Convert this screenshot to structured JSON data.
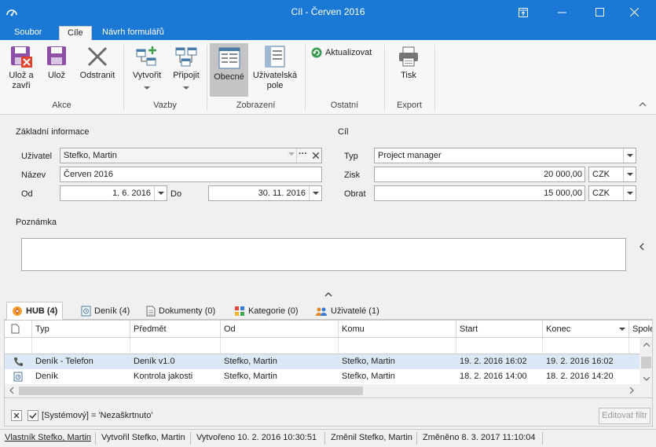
{
  "window": {
    "title": "Cíl - Červen 2016"
  },
  "ribbon_tabs": [
    "Soubor",
    "Cíle",
    "Návrh formulářů"
  ],
  "ribbon": {
    "buttons": {
      "save_close": [
        "Ulož a",
        "zavři"
      ],
      "save": "Ulož",
      "delete": "Odstranit",
      "create": "Vytvořit",
      "attach": "Připojit",
      "general": "Obecné",
      "user_fields": [
        "Uživatelská",
        "pole"
      ],
      "refresh": "Aktualizovat",
      "print": "Tisk"
    },
    "groups": {
      "actions": "Akce",
      "links": "Vazby",
      "view": "Zobrazení",
      "other": "Ostatní",
      "export": "Export"
    }
  },
  "form": {
    "basic_header": "Základní informace",
    "goal_header": "Cíl",
    "user_label": "Uživatel",
    "user_value": "Stefko, Martin",
    "name_label": "Název",
    "name_value": "Červen 2016",
    "from_label": "Od",
    "from_value": "1. 6. 2016",
    "to_label": "Do",
    "to_value": "30. 11. 2016",
    "type_label": "Typ",
    "type_value": "Project manager",
    "profit_label": "Zisk",
    "profit_value": "20 000,00",
    "profit_currency": "CZK",
    "turnover_label": "Obrat",
    "turnover_value": "15 000,00",
    "turnover_currency": "CZK",
    "note_label": "Poznámka",
    "note_value": ""
  },
  "bottom_tabs": [
    "HUB (4)",
    "Deník (4)",
    "Dokumenty (0)",
    "Kategorie (0)",
    "Uživatelé (1)"
  ],
  "grid": {
    "columns": [
      "Typ",
      "Předmět",
      "Od",
      "Komu",
      "Start",
      "Konec",
      "Spole"
    ],
    "rows": [
      {
        "type": "Deník - Telefon",
        "subject": "Deník v1.0",
        "from": "Stefko, Martin",
        "to": "Stefko, Martin",
        "start": "19. 2. 2016 16:02",
        "end": "19. 2. 2016 16:02"
      },
      {
        "type": "Deník",
        "subject": "Kontrola jakosti",
        "from": "Stefko, Martin",
        "to": "Stefko, Martin",
        "start": "18. 2. 2016 14:00",
        "end": "18. 2. 2016 14:20"
      }
    ]
  },
  "filter": {
    "text": "[Systémový] = 'Nezaškrtnuto'",
    "edit_button": "Editovat filtr"
  },
  "status": {
    "owner": "Vlastník Stefko, Martin",
    "created_by": "Vytvořil Stefko, Martin",
    "created": "Vytvořeno 10. 2. 2016 10:30:51",
    "modified_by": "Změnil Stefko, Martin",
    "modified": "Změněno 8. 3. 2017 11:10:04"
  },
  "colors": {
    "titlebar": "#1b78d4",
    "selected_row": "#dce8f5",
    "delete_x": "#e0442c"
  }
}
